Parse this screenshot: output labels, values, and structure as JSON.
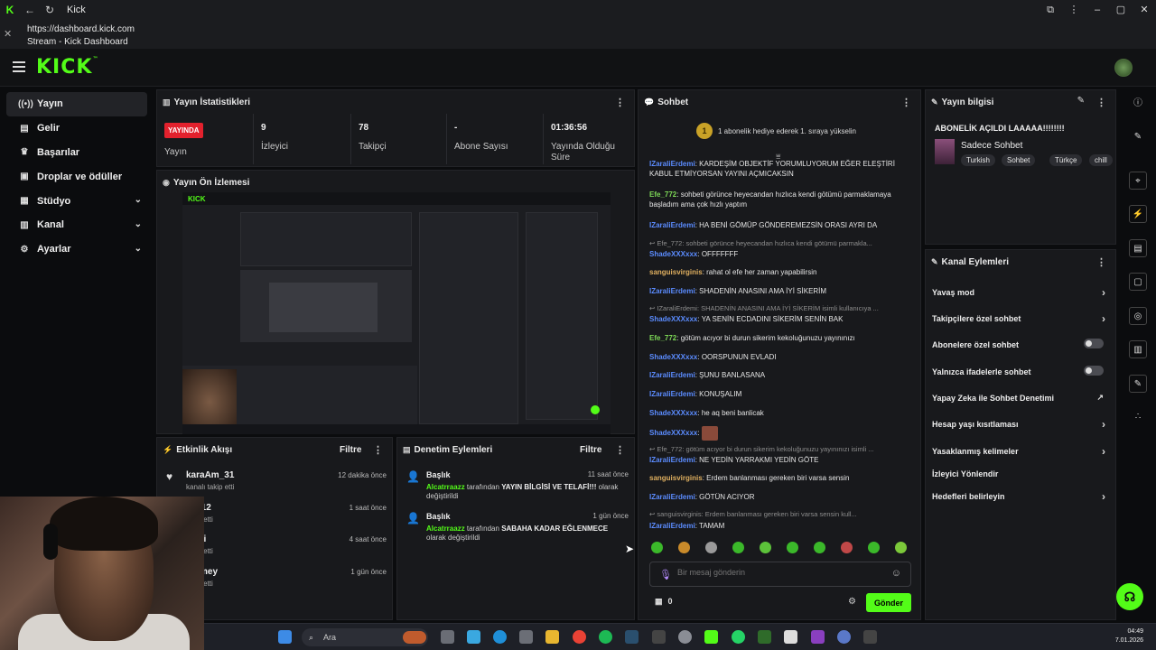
{
  "browser": {
    "tab_title": "Kick",
    "url": "https://dashboard.kick.com",
    "page_title": "Stream - Kick Dashboard"
  },
  "header": {
    "logo": "KICK"
  },
  "sidebar": {
    "items": [
      {
        "label": "Yayın",
        "icon": "broadcast-icon",
        "active": true
      },
      {
        "label": "Gelir",
        "icon": "wallet-icon"
      },
      {
        "label": "Başarılar",
        "icon": "trophy-icon"
      },
      {
        "label": "Droplar ve ödüller",
        "icon": "gift-icon"
      },
      {
        "label": "Stüdyo",
        "icon": "studio-icon",
        "expandable": true
      },
      {
        "label": "Kanal",
        "icon": "channel-icon",
        "expandable": true
      },
      {
        "label": "Ayarlar",
        "icon": "gear-icon",
        "expandable": true
      }
    ]
  },
  "stats": {
    "title": "Yayın İstatistikleri",
    "live_badge": "YAYINDA",
    "live_label": "Yayın",
    "viewers_value": "9",
    "viewers_label": "İzleyici",
    "followers_value": "78",
    "followers_label": "Takipçi",
    "subs_value": "-",
    "subs_label": "Abone Sayısı",
    "uptime_value": "01:36:56",
    "uptime_label": "Yayında Olduğu Süre"
  },
  "preview": {
    "title": "Yayın Ön İzlemesi"
  },
  "activity": {
    "title": "Etkinlik Akışı",
    "filter": "Filtre",
    "items": [
      {
        "name": "karaAm_31",
        "sub": "kanalı takip etti",
        "time": "12 dakika önce"
      },
      {
        "name": "p2112",
        "sub": "takip etti",
        "time": "1 saat önce"
      },
      {
        "name": "walti",
        "sub": "takip etti",
        "time": "4 saat önce"
      },
      {
        "name": "ommey",
        "sub": "takip etti",
        "time": "1 gün önce"
      }
    ]
  },
  "moderation": {
    "title": "Denetim Eylemleri",
    "filter": "Filtre",
    "items": [
      {
        "title": "Başlık",
        "time": "11 saat önce",
        "actor": "Alcatrraazz",
        "pre": "tarafından",
        "value": "YAYIN BİLGİSİ VE TELAFİ!!!",
        "post": "olarak değiştirildi"
      },
      {
        "title": "Başlık",
        "time": "1 gün önce",
        "actor": "Alcatrraazz",
        "pre": "tarafından",
        "value": "SABAHA KADAR EĞLENMECE",
        "post": "olarak değiştirildi"
      }
    ]
  },
  "chat": {
    "title": "Sohbet",
    "info_badge": "1",
    "info": "1 abonelik hediye ederek 1. sıraya yükselin",
    "messages": [
      {
        "user": "IZaraliErdemi",
        "text": "KARDEŞİM OBJEKTİF YORUMLUYORUM EĞER ELEŞTİRİ KABUL ETMİYORSAN YAYINI AÇMICAKSIN",
        "color": "#5b8cff"
      },
      {
        "user": "Efe_772",
        "text": "sohbeti görünce heyecandan hızlıca kendi götümü parmaklamaya başladım ama çok hızlı yaptım",
        "color": "#7ed957"
      },
      {
        "user": "IZaraliErdemi",
        "text": "HA BENİ GÖMÜP GÖNDEREMEZSİN ORASI AYRI DA",
        "color": "#5b8cff"
      },
      {
        "reply": "Efe_772: sohbeti görünce heyecandan hızlıca kendi götümü parmakla..."
      },
      {
        "user": "ShadeXXXxxx",
        "text": "OFFFFFFF",
        "color": "#5b8cff"
      },
      {
        "user": "sanguisvirginis",
        "text": "rahat ol efe her zaman yapabilirsin",
        "color": "#e0b060"
      },
      {
        "user": "IZaraliErdemi",
        "text": "SHADENİN ANASINI AMA İYİ SİKERİM",
        "color": "#5b8cff"
      },
      {
        "reply": "IZaraliErdemi: SHADENİN ANASINI AMA İYİ SİKERİM isimli kullanıcıya ..."
      },
      {
        "user": "ShadeXXXxxx",
        "text": "YA SENİN ECDADINI SİKERİM SENİN BAK",
        "color": "#5b8cff"
      },
      {
        "user": "Efe_772",
        "text": "götüm acıyor bi durun sikerim kekoluğunuzu yayınınızı",
        "color": "#7ed957"
      },
      {
        "user": "ShadeXXXxxx",
        "text": "OORSPUNUN EVLADI",
        "color": "#5b8cff"
      },
      {
        "user": "IZaraliErdemi",
        "text": "ŞUNU BANLASANA",
        "color": "#5b8cff"
      },
      {
        "user": "IZaraliErdemi",
        "text": "KONUŞALIM",
        "color": "#5b8cff"
      },
      {
        "user": "ShadeXXXxxx",
        "text": "he aq beni banlicak",
        "color": "#5b8cff"
      },
      {
        "user": "ShadeXXXxxx",
        "text": "",
        "color": "#5b8cff",
        "emote": true
      },
      {
        "reply": "Efe_772: götüm acıyor bi durun sikerim kekoluğunuzu yayınınızı isimli ..."
      },
      {
        "user": "IZaraliErdemi",
        "text": "NE YEDİN YARRAKMI YEDİN GÖTE",
        "color": "#5b8cff"
      },
      {
        "user": "sanguisvirginis",
        "text": "Erdem banlanması gereken biri varsa sensin",
        "color": "#e0b060"
      },
      {
        "user": "IZaraliErdemi",
        "text": "GÖTÜN ACIYOR",
        "color": "#5b8cff"
      },
      {
        "reply": "sanguisvirginis: Erdem banlanması gereken biri varsa sensin kull..."
      },
      {
        "user": "IZaraliErdemi",
        "text": "TAMAM",
        "color": "#5b8cff"
      }
    ],
    "input_placeholder": "Bir mesaj gönderin",
    "points": "0",
    "send": "Gönder"
  },
  "stream_info": {
    "title": "Yayın bilgisi",
    "stream_title": "ABONELİK AÇILDI LAAAAA!!!!!!!!",
    "category": "Sadece Sohbet",
    "tags": [
      "Turkish",
      "Sohbet",
      "Türkçe",
      "chill"
    ]
  },
  "channel_actions": {
    "title": "Kanal Eylemleri",
    "items": [
      {
        "label": "Yavaş mod",
        "kind": "arrow"
      },
      {
        "label": "Takipçilere özel sohbet",
        "kind": "arrow"
      },
      {
        "label": "Abonelere özel sohbet",
        "kind": "toggle"
      },
      {
        "label": "Yalnızca ifadelerle sohbet",
        "kind": "toggle"
      },
      {
        "label": "Yapay Zeka ile Sohbet Denetimi",
        "kind": "external"
      },
      {
        "label": "Hesap yaşı kısıtlaması",
        "kind": "arrow"
      },
      {
        "label": "Yasaklanmış kelimeler",
        "kind": "arrow"
      },
      {
        "label": "İzleyici Yönlendir",
        "kind": "none"
      },
      {
        "label": "Hedefleri belirleyin",
        "kind": "arrow"
      }
    ]
  },
  "taskbar": {
    "search": "Ara",
    "time": "04:49",
    "date": "7.01.2026"
  },
  "colors": {
    "brand": "#53fc18",
    "live": "#e3212d",
    "panel": "#18191c",
    "bg": "#0b0c0e"
  }
}
